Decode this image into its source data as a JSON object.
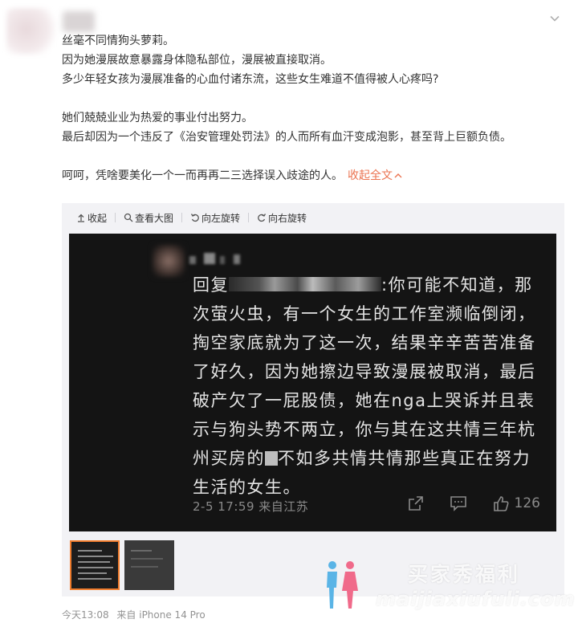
{
  "post": {
    "lines": [
      "丝毫不同情狗头萝莉。",
      "因为她漫展故意暴露身体隐私部位，漫展被直接取消。",
      "多少年轻女孩为漫展准备的心血付诸东流，这些女生难道不值得被人心疼吗?",
      "她们兢兢业业为热爱的事业付出努力。",
      "最后却因为一个违反了《治安管理处罚法》的人而所有血汗变成泡影，甚至背上巨额负债。",
      "呵呵，凭啥要美化一个一而再再二三选择误入歧途的人。"
    ],
    "collapse_label": "收起全文"
  },
  "toolbar": {
    "collapse": "收起",
    "view_large": "查看大图",
    "rotate_left": "向左旋转",
    "rotate_right": "向右旋转"
  },
  "screenshot": {
    "reply_prefix": "回复",
    "reply_rest": ":你可能不知道，那次萤火虫，有一个女生的工作室濒临倒闭，掏空家底就为了这一次，结果辛辛苦苦准备了好久，因为她擦边导致漫展被取消，最后破产欠了一屁股债，她在nga上哭诉并且表示与狗头势不两立，你与其在这共情三年杭州买房的",
    "reply_end": "不如多共情共情那些真正在努力生活的女生。",
    "meta": "2-5 17:59  来自江苏",
    "like_count": "126"
  },
  "watermark": {
    "text": "买家秀福利",
    "url": "maijiaxiufuli.com"
  },
  "footer": {
    "time": "今天13:08",
    "source": "来自 iPhone 14 Pro"
  }
}
